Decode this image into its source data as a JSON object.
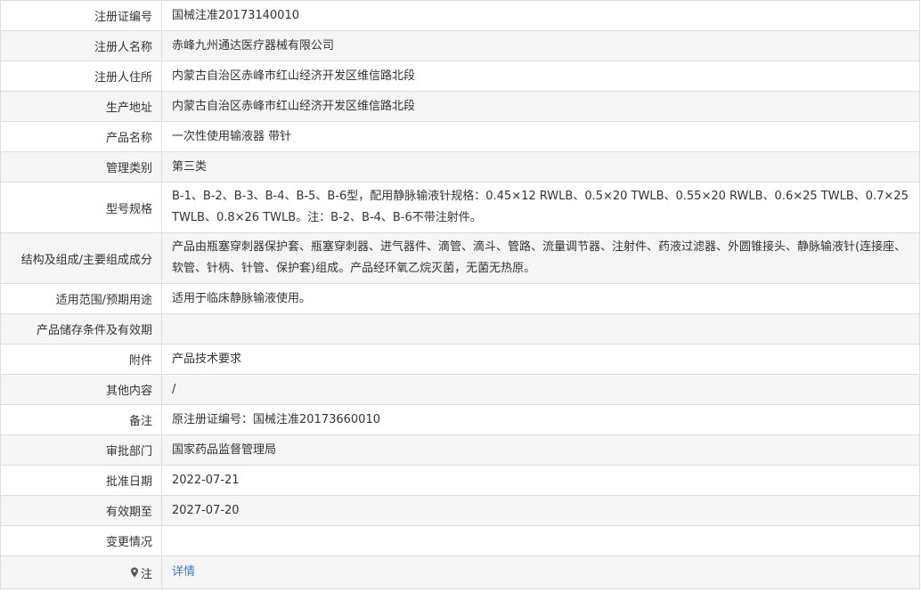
{
  "rows": [
    {
      "label": "注册证编号",
      "value": "国械注准20173140010"
    },
    {
      "label": "注册人名称",
      "value": "赤峰九州通达医疗器械有限公司"
    },
    {
      "label": "注册人住所",
      "value": "内蒙古自治区赤峰市红山经济开发区维信路北段"
    },
    {
      "label": "生产地址",
      "value": "内蒙古自治区赤峰市红山经济开发区维信路北段"
    },
    {
      "label": "产品名称",
      "value": "一次性使用输液器 带针"
    },
    {
      "label": "管理类别",
      "value": "第三类"
    },
    {
      "label": "型号规格",
      "value": "B-1、B-2、B-3、B-4、B-5、B-6型，配用静脉输液针规格：0.45×12 RWLB、0.5×20 TWLB、0.55×20 RWLB、0.6×25 TWLB、0.7×25 TWLB、0.8×26 TWLB。注：B-2、B-4、B-6不带注射件。"
    },
    {
      "label": "结构及组成/主要组成成分",
      "value": "产品由瓶塞穿刺器保护套、瓶塞穿刺器、进气器件、滴管、滴斗、管路、流量调节器、注射件、药液过滤器、外圆锥接头、静脉输液针(连接座、软管、针柄、针管、保护套)组成。产品经环氧乙烷灭菌，无菌无热原。"
    },
    {
      "label": "适用范围/预期用途",
      "value": "适用于临床静脉输液使用。"
    },
    {
      "label": "产品储存条件及有效期",
      "value": ""
    },
    {
      "label": "附件",
      "value": "产品技术要求"
    },
    {
      "label": "其他内容",
      "value": "/"
    },
    {
      "label": "备注",
      "value": "原注册证编号：国械注准20173660010"
    },
    {
      "label": "审批部门",
      "value": "国家药品监督管理局"
    },
    {
      "label": "批准日期",
      "value": "2022-07-21"
    },
    {
      "label": "有效期至",
      "value": "2027-07-20"
    },
    {
      "label": "变更情况",
      "value": ""
    }
  ],
  "note_row": {
    "label": "注",
    "link": "详情",
    "icon": "pin-icon"
  }
}
